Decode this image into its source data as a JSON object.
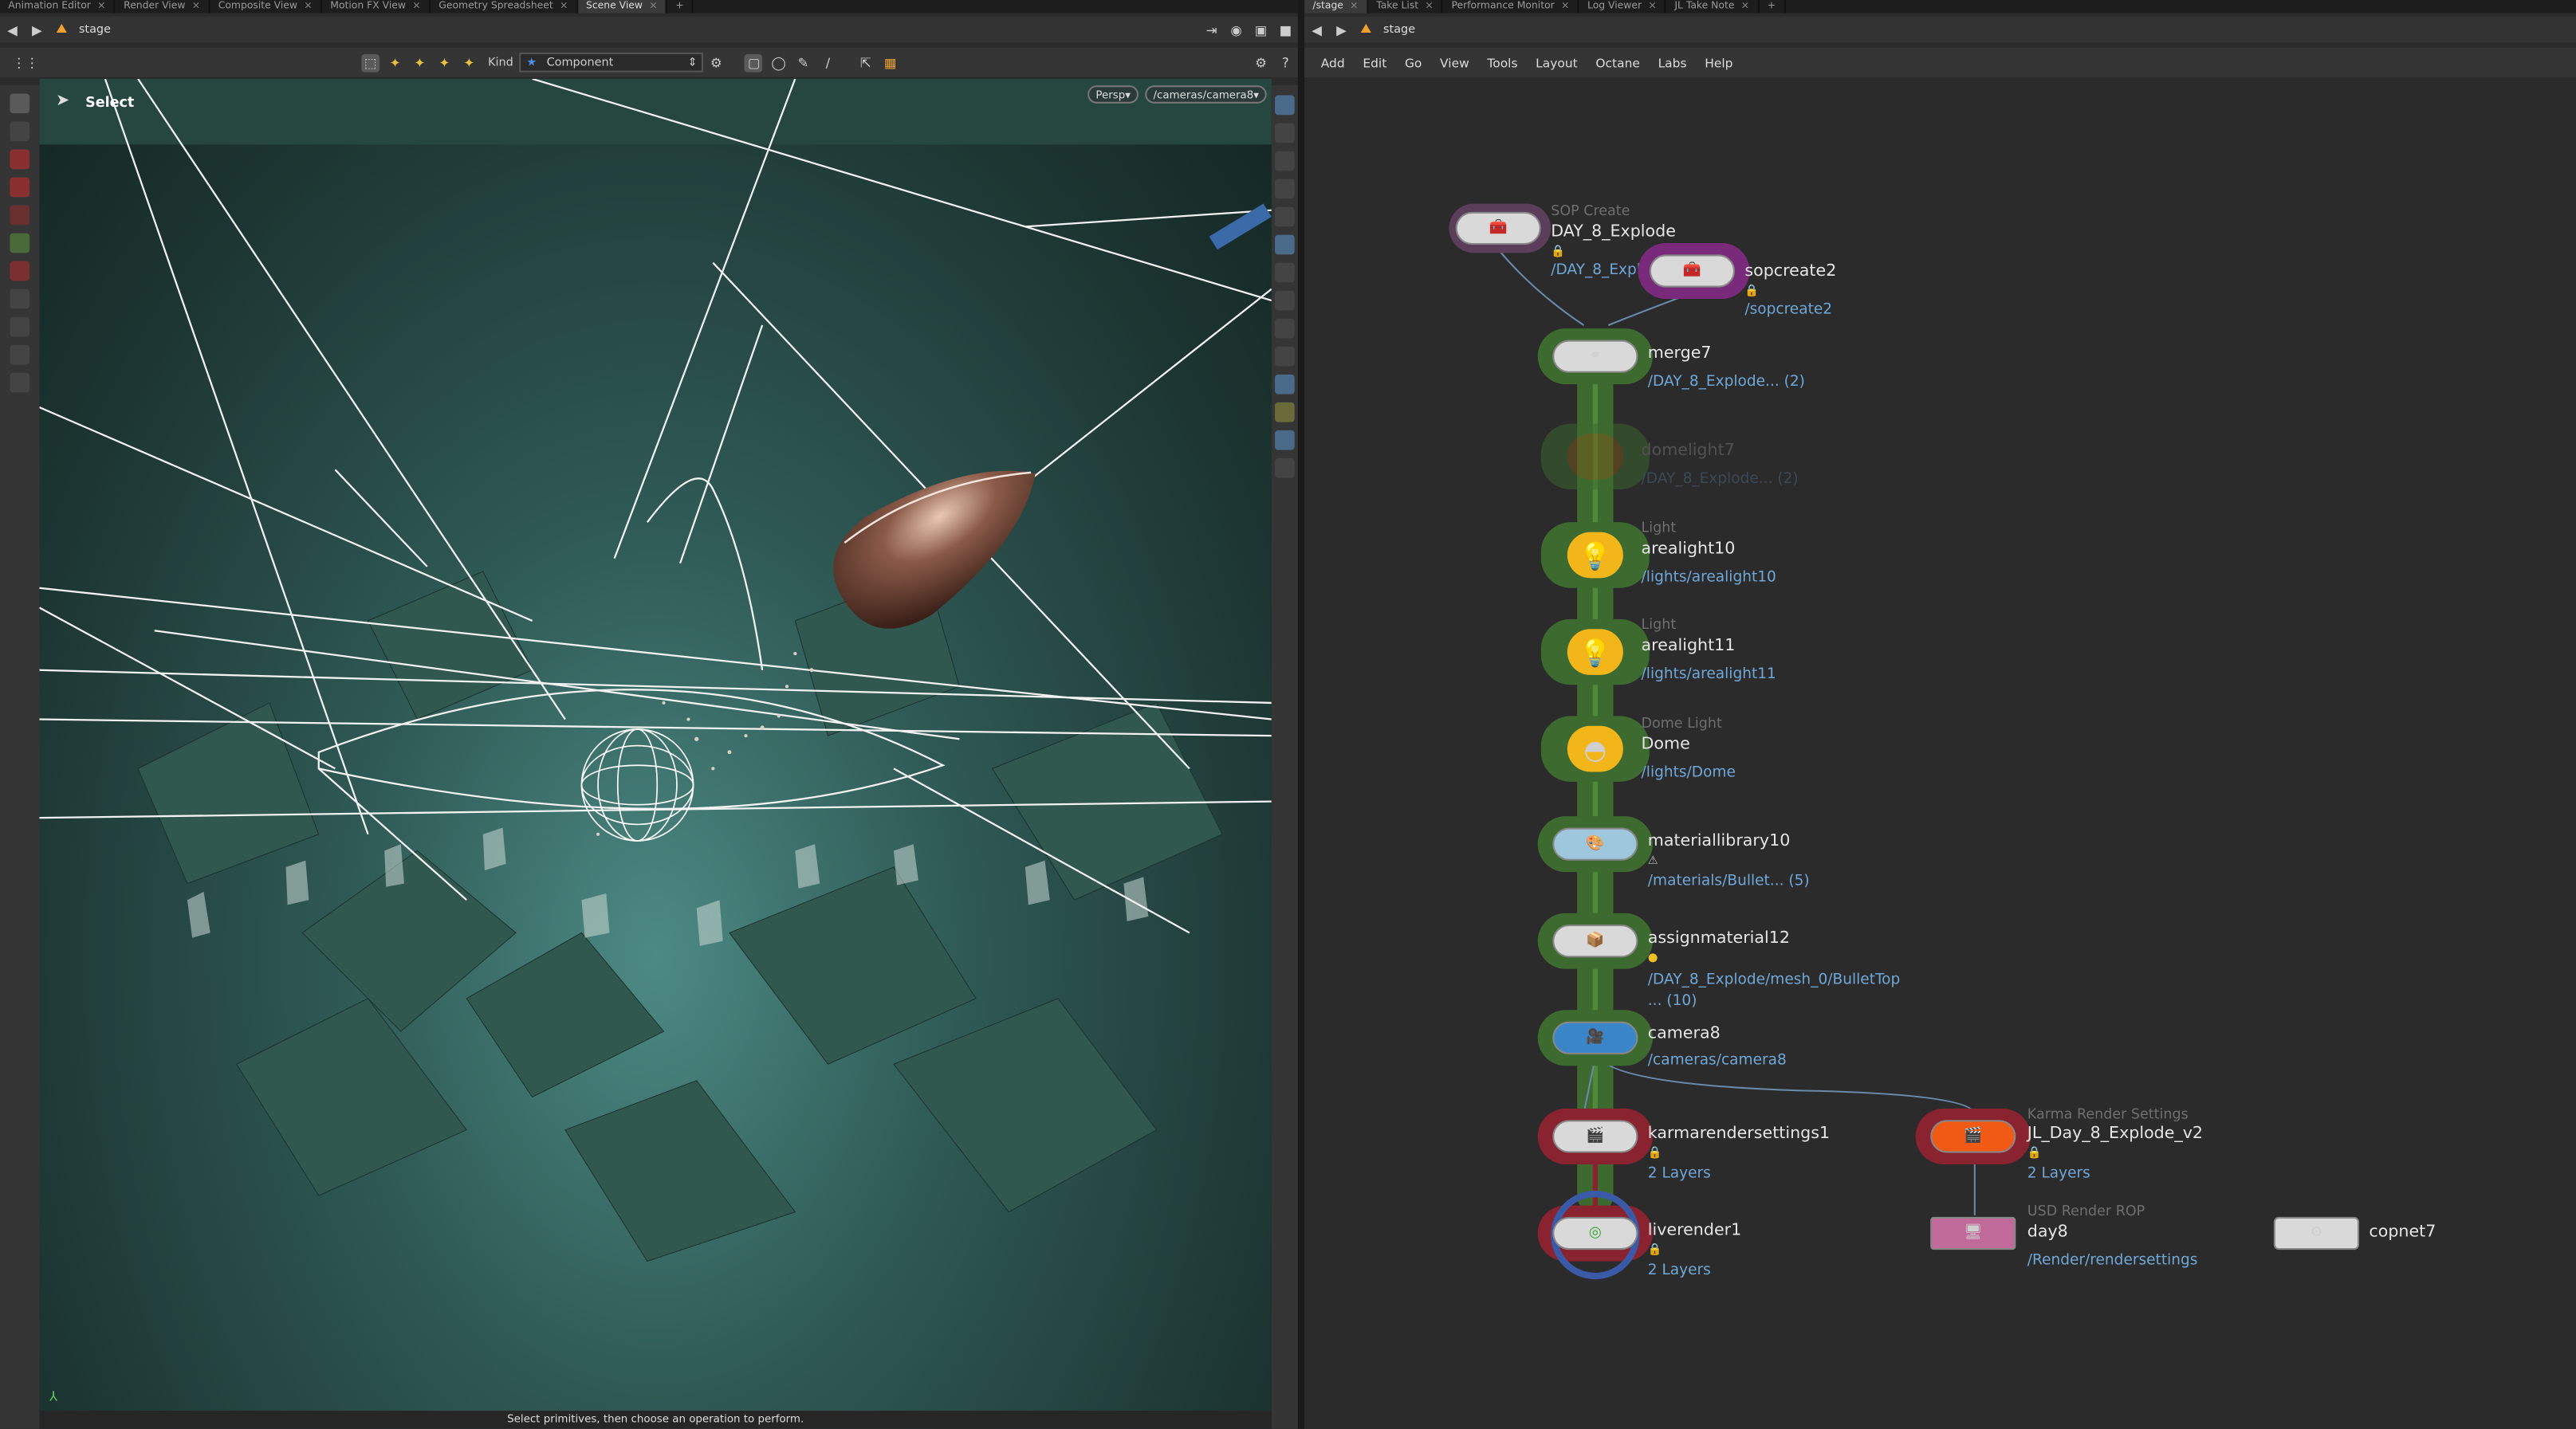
{
  "left_tabs": [
    "Animation Editor",
    "Render View",
    "Composite View",
    "Motion FX View",
    "Geometry Spreadsheet",
    "Scene View"
  ],
  "right_tabs": [
    "/stage",
    "Take List",
    "Performance Monitor",
    "Log Viewer",
    "JL Take Note"
  ],
  "left_path": "stage",
  "right_path": "stage",
  "viewport": {
    "kind_label": "Kind",
    "kind_value": "Component",
    "select_label": "Select",
    "persp_label": "Persp",
    "camera_label": "/cameras/camera8",
    "status_text": "Select primitives, then choose an operation to perform."
  },
  "network_menu": [
    "Add",
    "Edit",
    "Go",
    "View",
    "Tools",
    "Layout",
    "Octane",
    "Labs",
    "Help"
  ],
  "nodes": {
    "day8explode": {
      "type": "SOP Create",
      "name": "DAY_8_Explode",
      "path": "/DAY_8_Explode"
    },
    "sopcreate2": {
      "name": "sopcreate2",
      "path": "/sopcreate2"
    },
    "merge7": {
      "name": "merge7",
      "path": "/DAY_8_Explode... (2)"
    },
    "domelight7": {
      "name": "domelight7",
      "path": "/DAY_8_Explode... (2)"
    },
    "arealight10": {
      "type": "Light",
      "name": "arealight10",
      "path": "/lights/arealight10"
    },
    "arealight11": {
      "type": "Light",
      "name": "arealight11",
      "path": "/lights/arealight11"
    },
    "dome": {
      "type": "Dome Light",
      "name": "Dome",
      "path": "/lights/Dome"
    },
    "materiallibrary10": {
      "name": "materiallibrary10",
      "path": "/materials/Bullet... (5)"
    },
    "assignmaterial12": {
      "name": "assignmaterial12",
      "path": "/DAY_8_Explode/mesh_0/BulletTop",
      "path2": "... (10)"
    },
    "camera8": {
      "name": "camera8",
      "path": "/cameras/camera8"
    },
    "karmarendersettings1": {
      "name": "karmarendersettings1",
      "path": "2 Layers"
    },
    "jlday8": {
      "type": "Karma Render Settings",
      "name": "JL_Day_8_Explode_v2",
      "path": "2 Layers"
    },
    "liverender1": {
      "name": "liverender1",
      "path": "2 Layers"
    },
    "day8": {
      "type": "USD Render ROP",
      "name": "day8",
      "path": "/Render/rendersettings"
    },
    "copnet7": {
      "name": "copnet7"
    }
  },
  "colors": {
    "background": "#2b2b2b",
    "path_blue": "#6fa8d8",
    "wire_green": "#3d6a2f",
    "light_yellow": "#f2b51a",
    "karma_red": "#8a2330",
    "karma_orange": "#f05a14",
    "camera_blue": "#3a86c8"
  }
}
